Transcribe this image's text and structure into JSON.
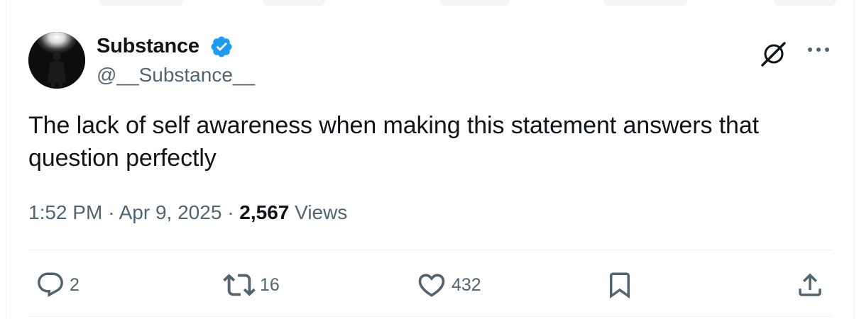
{
  "tweet": {
    "author": {
      "name": "Substance",
      "handle": "@__Substance__",
      "verified": true,
      "badge_color": "#1d9bf0"
    },
    "text": "The lack of self awareness when making this statement answers that question perfectly",
    "time": "1:52 PM",
    "separator": "·",
    "date": "Apr 9, 2025",
    "views_count": "2,567",
    "views_label": "Views"
  },
  "actions": {
    "replies": "2",
    "reposts": "16",
    "likes": "432"
  },
  "icons": {
    "grok": "grok-icon",
    "more": "more-options-icon",
    "reply": "reply-icon",
    "repost": "repost-icon",
    "like": "heart-icon",
    "bookmark": "bookmark-icon",
    "share": "share-icon"
  },
  "colors": {
    "text_primary": "#0f1419",
    "text_secondary": "#536471",
    "divider": "#eff3f4"
  }
}
